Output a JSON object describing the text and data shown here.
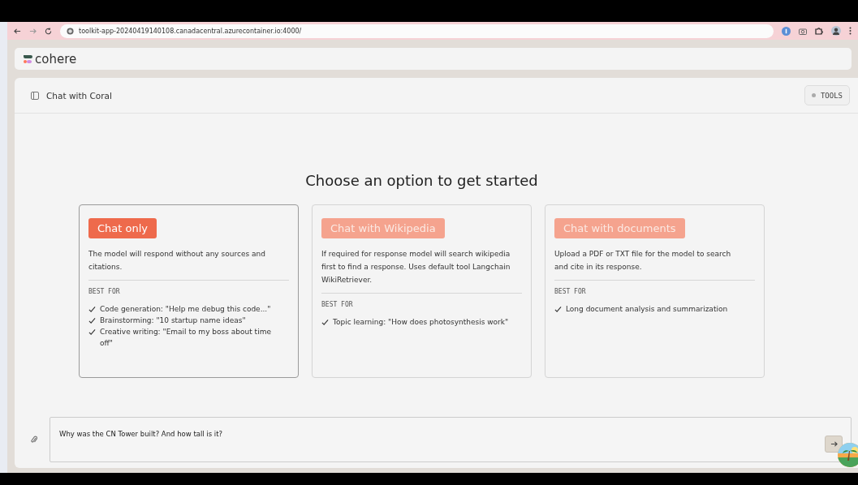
{
  "browser": {
    "url": "toolkit-app-20240419140108.canadacentral.azurecontainer.io:4000/"
  },
  "app": {
    "logo": "cohere"
  },
  "header": {
    "title": "Chat with Coral",
    "tools_button": "TOOLS"
  },
  "heading": "Choose an option to get started",
  "options": [
    {
      "label": "Chat only",
      "selected": true,
      "description": "The model will respond without any sources and citations.",
      "best_for_label": "BEST FOR",
      "uses": [
        "Code generation: \"Help me debug this code...\"",
        "Brainstorming: \"10 startup name ideas\"",
        "Creative writing: \"Email to my boss about time off\""
      ]
    },
    {
      "label": "Chat with Wikipedia",
      "selected": false,
      "description": "If required for response model will search wikipedia first to find a response. Uses default tool Langchain WikiRetriever.",
      "best_for_label": "BEST FOR",
      "uses": [
        "Topic learning: \"How does photosynthesis work\""
      ]
    },
    {
      "label": "Chat with documents",
      "selected": false,
      "description": "Upload a PDF or TXT file for the model to search and cite in its response.",
      "best_for_label": "BEST FOR",
      "uses": [
        "Long document analysis and summarization"
      ]
    }
  ],
  "composer": {
    "value": "Why was the CN Tower built? And how tall is it?"
  }
}
